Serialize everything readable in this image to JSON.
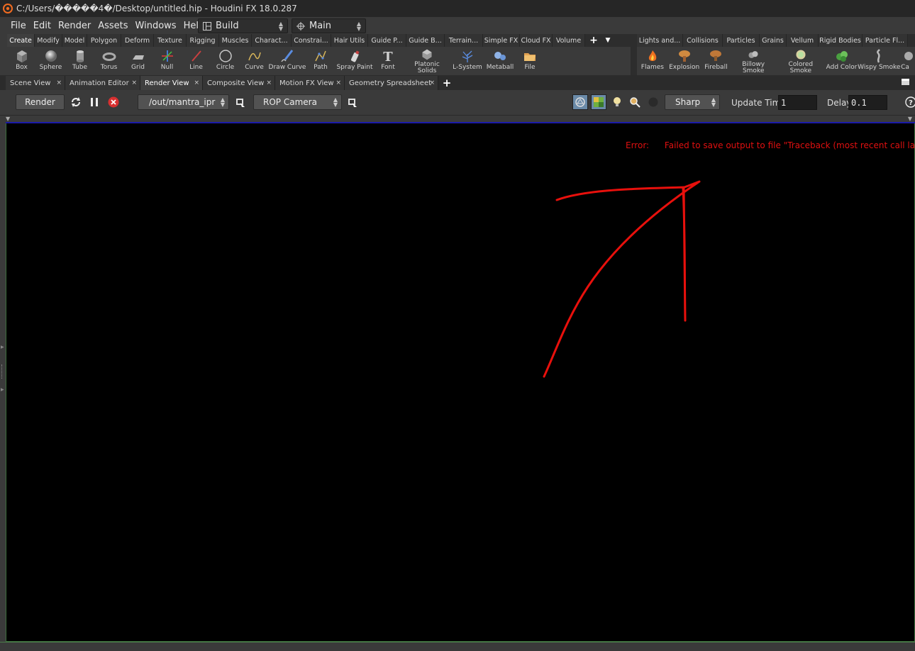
{
  "window": {
    "title": "C:/Users/�����4�/Desktop/untitled.hip - Houdini FX 18.0.287"
  },
  "menu": [
    "File",
    "Edit",
    "Render",
    "Assets",
    "Windows",
    "Help"
  ],
  "desktop": {
    "build_label": "Build",
    "main_label": "Main"
  },
  "shelf_left": {
    "tabs": [
      "Create",
      "Modify",
      "Model",
      "Polygon",
      "Deform",
      "Texture",
      "Rigging",
      "Muscles",
      "Charact...",
      "Constrai...",
      "Hair Utils",
      "Guide P...",
      "Guide B...",
      "Terrain...",
      "Simple FX",
      "Cloud FX",
      "Volume"
    ],
    "tools": [
      {
        "label": "Box",
        "icon": "box-icon"
      },
      {
        "label": "Sphere",
        "icon": "sphere-icon"
      },
      {
        "label": "Tube",
        "icon": "tube-icon"
      },
      {
        "label": "Torus",
        "icon": "torus-icon"
      },
      {
        "label": "Grid",
        "icon": "grid-icon"
      },
      {
        "label": "Null",
        "icon": "null-icon"
      },
      {
        "label": "Line",
        "icon": "line-icon"
      },
      {
        "label": "Circle",
        "icon": "circle-icon"
      },
      {
        "label": "Curve",
        "icon": "curve-icon"
      },
      {
        "label": "Draw Curve",
        "icon": "draw-curve-icon"
      },
      {
        "label": "Path",
        "icon": "path-icon"
      },
      {
        "label": "Spray Paint",
        "icon": "spray-paint-icon"
      },
      {
        "label": "Font",
        "icon": "font-icon"
      },
      {
        "label": "Platonic Solids",
        "icon": "platonic-solids-icon"
      },
      {
        "label": "L-System",
        "icon": "l-system-icon"
      },
      {
        "label": "Metaball",
        "icon": "metaball-icon"
      },
      {
        "label": "File",
        "icon": "file-icon"
      }
    ]
  },
  "shelf_right": {
    "tabs": [
      "Lights and...",
      "Collisions",
      "Particles",
      "Grains",
      "Vellum",
      "Rigid Bodies",
      "Particle Fl..."
    ],
    "tools": [
      {
        "label": "Flames",
        "icon": "flames-icon"
      },
      {
        "label": "Explosion",
        "icon": "explosion-icon"
      },
      {
        "label": "Fireball",
        "icon": "fireball-icon"
      },
      {
        "label": "Billowy Smoke",
        "icon": "billowy-smoke-icon"
      },
      {
        "label": "Colored Smoke",
        "icon": "colored-smoke-icon"
      },
      {
        "label": "Add Color",
        "icon": "add-color-icon"
      },
      {
        "label": "Wispy Smoke",
        "icon": "wispy-smoke-icon"
      },
      {
        "label": "Ca",
        "icon": "cut-off-icon"
      }
    ]
  },
  "pane_tabs": [
    "Scene View",
    "Animation Editor",
    "Render View",
    "Composite View",
    "Motion FX View",
    "Geometry Spreadsheet"
  ],
  "render_toolbar": {
    "render_label": "Render",
    "rop_path": "/out/mantra_ipr",
    "camera": "ROP Camera",
    "preview_mode": "Sharp",
    "update_time_label": "Update Time",
    "update_time_value": "1",
    "delay_label": "Delay",
    "delay_value": "0.1"
  },
  "viewer": {
    "error_label": "Error:",
    "error_message": "Failed to save output to file \"Traceback (most recent call last):"
  },
  "colors": {
    "error": "#e01010",
    "annotation": "#e8100c",
    "progress_bar": "#1a1aa8"
  }
}
